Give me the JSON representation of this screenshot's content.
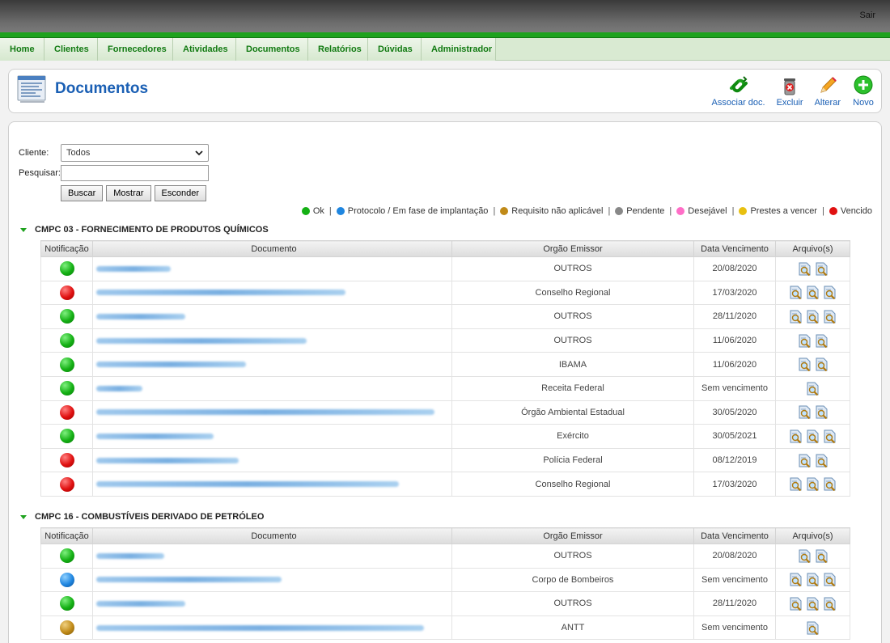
{
  "topbar": {
    "logout_label": "Sair"
  },
  "nav": {
    "items": [
      "Home",
      "Clientes",
      "Fornecedores",
      "Atividades",
      "Documentos",
      "Relatórios",
      "Dúvidas",
      "Administrador"
    ]
  },
  "page": {
    "title": "Documentos",
    "actions": {
      "associar": "Associar doc.",
      "excluir": "Excluir",
      "alterar": "Alterar",
      "novo": "Novo"
    }
  },
  "filter": {
    "cliente_label": "Cliente:",
    "cliente_value": "Todos",
    "pesquisar_label": "Pesquisar:",
    "pesquisar_value": "",
    "buscar": "Buscar",
    "mostrar": "Mostrar",
    "esconder": "Esconder"
  },
  "legend": [
    {
      "label": "Ok",
      "color": "#14b014"
    },
    {
      "label": "Protocolo / Em fase de implantação",
      "color": "#1f86e0"
    },
    {
      "label": "Requisito não aplicável",
      "color": "#c08a18"
    },
    {
      "label": "Pendente",
      "color": "#888888"
    },
    {
      "label": "Desejável",
      "color": "#ff6ec7"
    },
    {
      "label": "Prestes a vencer",
      "color": "#e8c010"
    },
    {
      "label": "Vencido",
      "color": "#e01010"
    }
  ],
  "columns": {
    "notificacao": "Notificação",
    "documento": "Documento",
    "orgao": "Orgão Emissor",
    "data": "Data Vencimento",
    "arquivos": "Arquivo(s)"
  },
  "sections": [
    {
      "title": "CMPC 03 - FORNECIMENTO DE PRODUTOS QUÍMICOS",
      "rows": [
        {
          "status": "green",
          "doc_width": 0.21,
          "orgao": "OUTROS",
          "data": "20/08/2020",
          "files": 2
        },
        {
          "status": "red",
          "doc_width": 0.7,
          "orgao": "Conselho Regional",
          "data": "17/03/2020",
          "files": 3
        },
        {
          "status": "green",
          "doc_width": 0.25,
          "orgao": "OUTROS",
          "data": "28/11/2020",
          "files": 3
        },
        {
          "status": "green",
          "doc_width": 0.59,
          "orgao": "OUTROS",
          "data": "11/06/2020",
          "files": 2
        },
        {
          "status": "green",
          "doc_width": 0.42,
          "orgao": "IBAMA",
          "data": "11/06/2020",
          "files": 2
        },
        {
          "status": "green",
          "doc_width": 0.13,
          "orgao": "Receita Federal",
          "data": "Sem vencimento",
          "files": 1
        },
        {
          "status": "red",
          "doc_width": 0.95,
          "orgao": "Órgão Ambiental Estadual",
          "data": "30/05/2020",
          "files": 2
        },
        {
          "status": "green",
          "doc_width": 0.33,
          "orgao": "Exército",
          "data": "30/05/2021",
          "files": 3
        },
        {
          "status": "red",
          "doc_width": 0.4,
          "orgao": "Polícia Federal",
          "data": "08/12/2019",
          "files": 2
        },
        {
          "status": "red",
          "doc_width": 0.85,
          "orgao": "Conselho Regional",
          "data": "17/03/2020",
          "files": 3
        }
      ]
    },
    {
      "title": "CMPC 16 - COMBUSTÍVEIS DERIVADO DE PETRÓLEO",
      "rows": [
        {
          "status": "green",
          "doc_width": 0.19,
          "orgao": "OUTROS",
          "data": "20/08/2020",
          "files": 2
        },
        {
          "status": "blue",
          "doc_width": 0.52,
          "orgao": "Corpo de Bombeiros",
          "data": "Sem vencimento",
          "files": 3
        },
        {
          "status": "green",
          "doc_width": 0.25,
          "orgao": "OUTROS",
          "data": "28/11/2020",
          "files": 3
        },
        {
          "status": "brown",
          "doc_width": 0.92,
          "orgao": "ANTT",
          "data": "Sem vencimento",
          "files": 1
        }
      ]
    }
  ]
}
